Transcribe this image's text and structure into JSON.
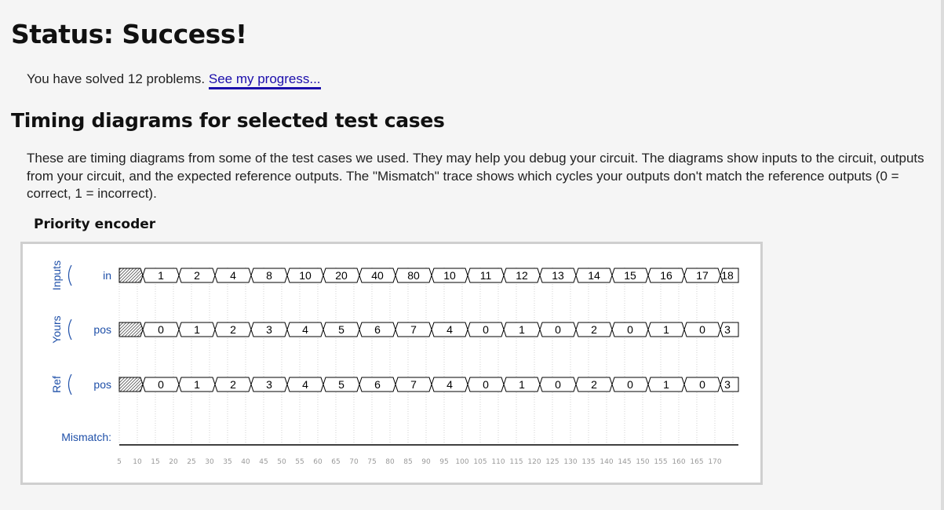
{
  "status": {
    "heading": "Status: Success!",
    "solved_prefix": "You have solved 12 problems. ",
    "progress_link": "See my progress..."
  },
  "timing": {
    "heading": "Timing diagrams for selected test cases",
    "description": "These are timing diagrams from some of the test cases we used. They may help you debug your circuit. The diagrams show inputs to the circuit, outputs from your circuit, and the expected reference outputs. The \"Mismatch\" trace shows which cycles your outputs don't match the reference outputs (0 = correct, 1 = incorrect).",
    "test_case_title": "Priority encoder"
  },
  "waveform": {
    "groups": [
      {
        "label": "Inputs",
        "signal": "in",
        "values": [
          "1",
          "2",
          "4",
          "8",
          "10",
          "20",
          "40",
          "80",
          "10",
          "11",
          "12",
          "13",
          "14",
          "15",
          "16",
          "17",
          "18"
        ]
      },
      {
        "label": "Yours",
        "signal": "pos",
        "values": [
          "0",
          "1",
          "2",
          "3",
          "4",
          "5",
          "6",
          "7",
          "4",
          "0",
          "1",
          "0",
          "2",
          "0",
          "1",
          "0",
          "3"
        ]
      },
      {
        "label": "Ref",
        "signal": "pos",
        "values": [
          "0",
          "1",
          "2",
          "3",
          "4",
          "5",
          "6",
          "7",
          "4",
          "0",
          "1",
          "0",
          "2",
          "0",
          "1",
          "0",
          "3"
        ]
      }
    ],
    "mismatch_label": "Mismatch:",
    "time_ticks": [
      "5",
      "10",
      "15",
      "20",
      "25",
      "30",
      "35",
      "40",
      "45",
      "50",
      "55",
      "60",
      "65",
      "70",
      "75",
      "80",
      "85",
      "90",
      "95",
      "100",
      "105",
      "110",
      "115",
      "120",
      "125",
      "130",
      "135",
      "140",
      "145",
      "150",
      "155",
      "160",
      "165",
      "170"
    ],
    "colors": {
      "label": "#1e4fa8",
      "tick": "#999999",
      "grid": "#c8c8c8",
      "trace": "#000000"
    }
  }
}
